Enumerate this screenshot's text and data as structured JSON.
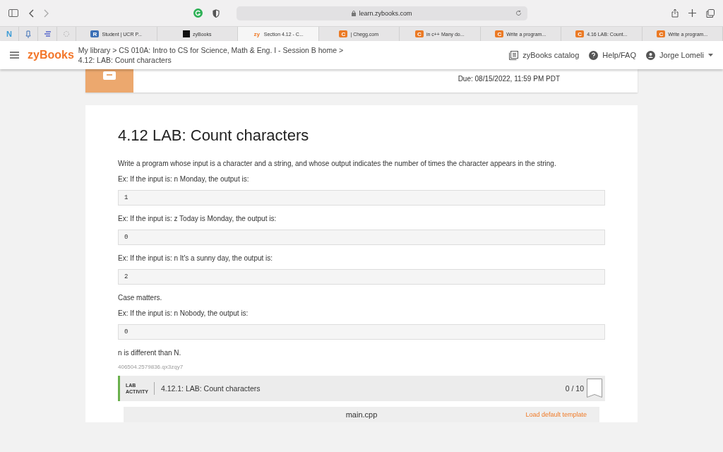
{
  "browser": {
    "address": "learn.zybooks.com"
  },
  "pinned_tabs": [
    {
      "kind": "letter",
      "badge": "N"
    },
    {
      "kind": "pin"
    },
    {
      "kind": "bars"
    },
    {
      "kind": "dots"
    }
  ],
  "tabs": [
    {
      "label": "Student | UCR P...",
      "badge": "R",
      "color": "#3b6fb6",
      "selected": false
    },
    {
      "label": "zyBooks",
      "color": "#111111",
      "selected": false
    },
    {
      "label": "Section 4.12 - C...",
      "badge": "zy",
      "color": "#f07a26",
      "selected": true
    },
    {
      "label": "| Chegg.com",
      "badge": "C",
      "color": "#eb7a25",
      "selected": false
    },
    {
      "label": "in c++ Many do...",
      "badge": "C",
      "color": "#eb7a25",
      "selected": false
    },
    {
      "label": "Write a program...",
      "badge": "C",
      "color": "#eb7a25",
      "selected": false
    },
    {
      "label": "4.16 LAB: Count...",
      "badge": "C",
      "color": "#eb7a25",
      "selected": false
    },
    {
      "label": "Write a program...",
      "badge": "C",
      "color": "#eb7a25",
      "selected": false
    }
  ],
  "header": {
    "logo": "zyBooks",
    "breadcrumb": "My library > CS 010A: Intro to CS for Science, Math & Eng. I - Session B home >",
    "page": "4.12: LAB: Count characters",
    "catalog": "zyBooks catalog",
    "help": "Help/FAQ",
    "user": "Jorge Lomeli"
  },
  "assignment": {
    "due": "Due: 08/15/2022, 11:59 PM PDT"
  },
  "section": {
    "title": "4.12 LAB: Count characters",
    "blocks": [
      {
        "kind": "text",
        "text": "Write a program whose input is a character and a string, and whose output indicates the number of times the character appears in the string."
      },
      {
        "kind": "text",
        "text": "Ex: If the input is: n Monday, the output is:"
      },
      {
        "kind": "output",
        "text": "1"
      },
      {
        "kind": "text",
        "text": "Ex: If the input is: z Today is Monday, the output is:"
      },
      {
        "kind": "output",
        "text": "0"
      },
      {
        "kind": "text",
        "text": "Ex: If the input is: n It's a sunny day, the output is:"
      },
      {
        "kind": "output",
        "text": "2"
      },
      {
        "kind": "text",
        "text": "Case matters."
      },
      {
        "kind": "text",
        "text": "Ex: If the input is: n Nobody, the output is:"
      },
      {
        "kind": "output",
        "text": "0"
      },
      {
        "kind": "text",
        "text": "n is different than N."
      },
      {
        "kind": "id",
        "text": "406504.2579836.qx3zqy7"
      }
    ],
    "lab": {
      "tag_top": "LAB",
      "tag_bottom": "ACTIVITY",
      "title": "4.12.1: LAB: Count characters",
      "score": "0 / 10",
      "file": "main.cpp",
      "template": "Load default template"
    }
  }
}
